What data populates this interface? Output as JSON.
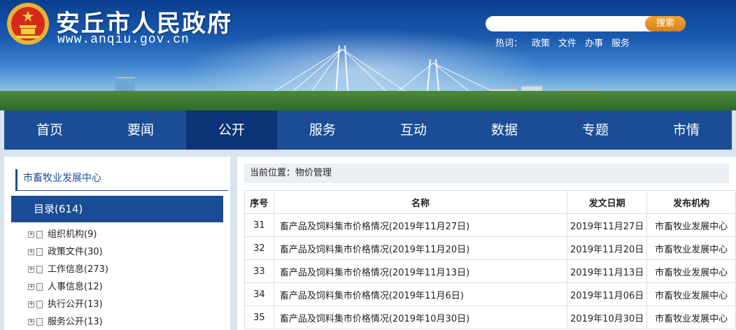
{
  "header": {
    "site_title": "安丘市人民政府",
    "site_url": "www.anqiu.gov.cn",
    "search_placeholder": "",
    "search_button": "搜索",
    "hot_label": "热词：",
    "hot_links": [
      "政策",
      "文件",
      "办事",
      "服务"
    ]
  },
  "nav": {
    "items": [
      "首页",
      "要闻",
      "公开",
      "服务",
      "互动",
      "数据",
      "专题",
      "市情"
    ],
    "active_index": 2
  },
  "sidebar": {
    "title": "市畜牧业发展中心",
    "catalog": "目录(614)",
    "items": [
      "组织机构(9)",
      "政策文件(30)",
      "工作信息(273)",
      "人事信息(12)",
      "执行公开(13)",
      "服务公开(13)"
    ]
  },
  "main": {
    "breadcrumb": "当前位置：物价管理",
    "columns": [
      "序号",
      "名称",
      "发文日期",
      "发布机构"
    ],
    "rows": [
      [
        "31",
        "畜产品及饲料集市价格情况(2019年11月27日)",
        "2019年11月27日",
        "市畜牧业发展中心"
      ],
      [
        "32",
        "畜产品及饲料集市价格情况(2019年11月20日)",
        "2019年11月20日",
        "市畜牧业发展中心"
      ],
      [
        "33",
        "畜产品及饲料集市价格情况(2019年11月13日)",
        "2019年11月13日",
        "市畜牧业发展中心"
      ],
      [
        "34",
        "畜产品及饲料集市价格情况(2019年11月6日)",
        "2019年11月06日",
        "市畜牧业发展中心"
      ],
      [
        "35",
        "畜产品及饲料集市价格情况(2019年10月30日)",
        "2019年10月30日",
        "市畜牧业发展中心"
      ]
    ]
  },
  "colors": {
    "nav_bg": "#1a4d96",
    "nav_active": "#0c3378",
    "accent_orange": "#e8921f"
  }
}
